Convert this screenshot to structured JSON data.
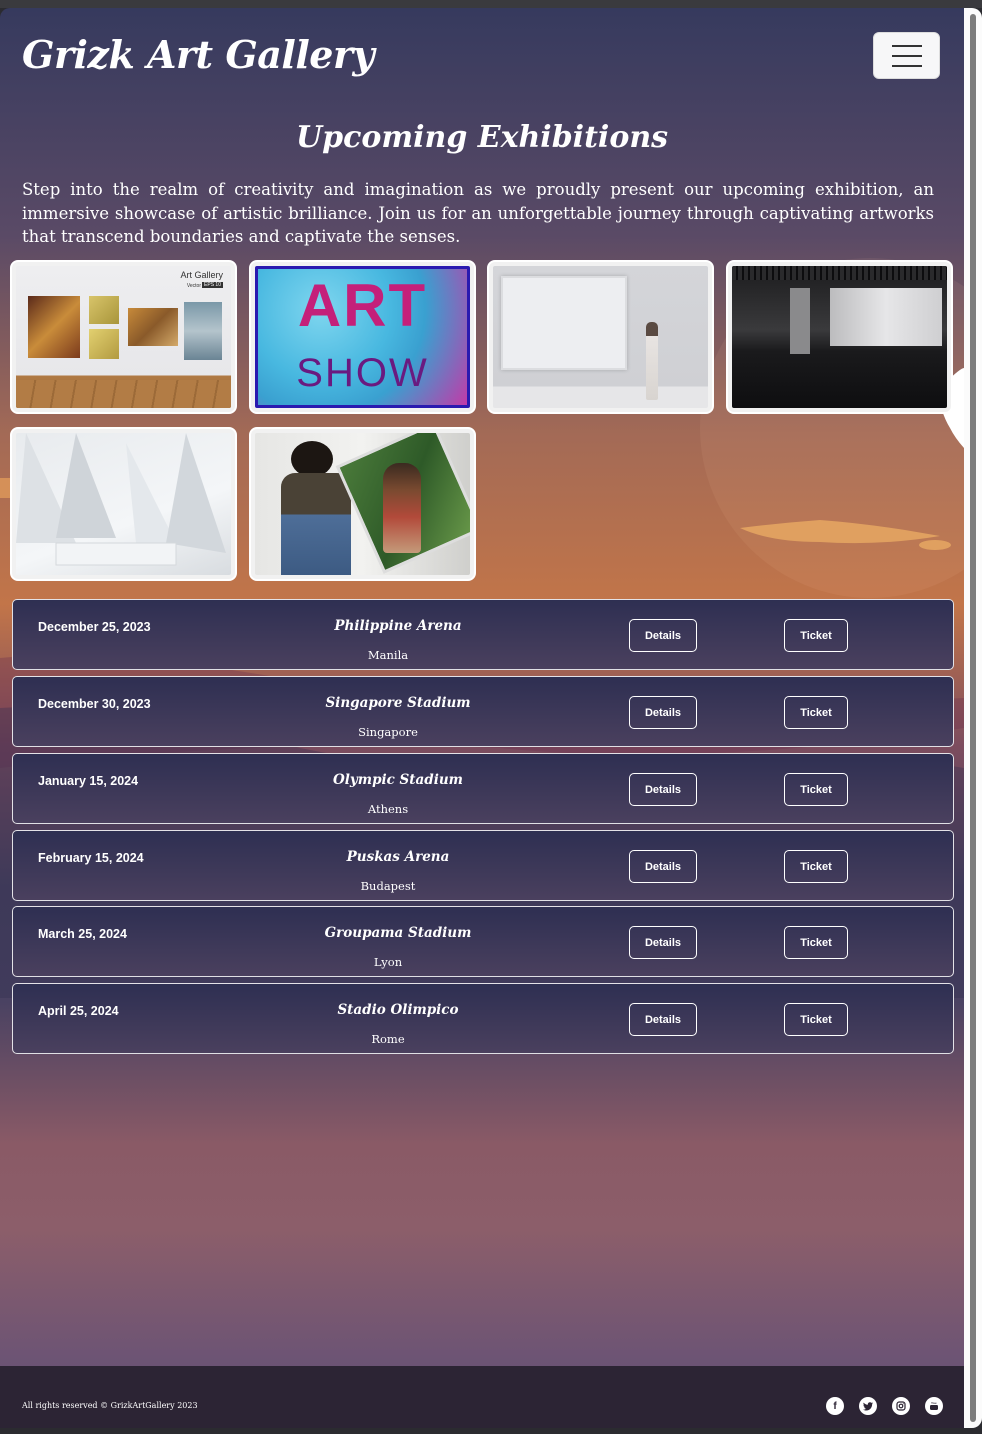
{
  "brand": "Grizk Art Gallery",
  "section_title": "Upcoming Exhibitions",
  "intro": "Step into the realm of creativity and imagination as we proudly present our upcoming exhibition, an immersive showcase of artistic brilliance. Join us for an unforgettable journey through captivating artworks that transcend boundaries and captivate the senses.",
  "gallery": {
    "thumb1": {
      "title": "Art Gallery",
      "sub": "Vector",
      "badge": "EPS 10"
    },
    "thumb2": {
      "line1": "ART",
      "line2": "SHOW"
    }
  },
  "buttons": {
    "details": "Details",
    "ticket": "Ticket"
  },
  "events": [
    {
      "date": "December 25, 2023",
      "venue": "Philippine Arena",
      "city": "Manila"
    },
    {
      "date": "December 30, 2023",
      "venue": "Singapore Stadium",
      "city": "Singapore"
    },
    {
      "date": "January 15, 2024",
      "venue": "Olympic Stadium",
      "city": "Athens"
    },
    {
      "date": "February 15, 2024",
      "venue": "Puskas Arena",
      "city": "Budapest"
    },
    {
      "date": "March 25, 2024",
      "venue": "Groupama Stadium",
      "city": "Lyon"
    },
    {
      "date": "April 25, 2024",
      "venue": "Stadio Olimpico",
      "city": "Rome"
    }
  ],
  "footer": {
    "copyright": "All rights reserved © GrizkArtGallery 2023",
    "social": [
      "facebook-icon",
      "twitter-icon",
      "instagram-icon",
      "youtube-icon"
    ]
  }
}
